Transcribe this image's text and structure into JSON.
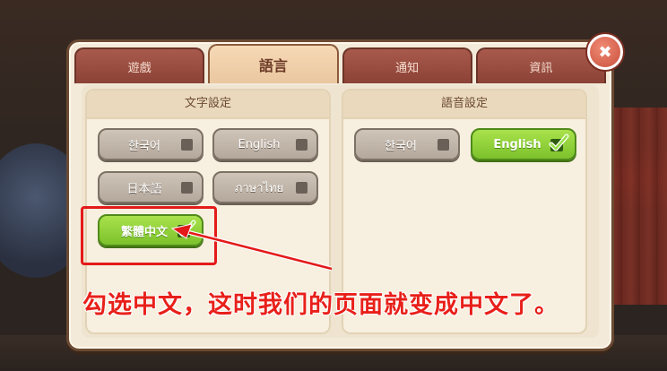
{
  "tabs": [
    {
      "label": "遊戲",
      "active": false
    },
    {
      "label": "語言",
      "active": true
    },
    {
      "label": "通知",
      "active": false
    },
    {
      "label": "資訊",
      "active": false
    }
  ],
  "text_settings": {
    "title": "文字設定",
    "options": [
      {
        "label": "한국어",
        "selected": false
      },
      {
        "label": "English",
        "selected": false
      },
      {
        "label": "日本語",
        "selected": false
      },
      {
        "label": "ภาษาไทย",
        "selected": false
      },
      {
        "label": "繁體中文",
        "selected": true
      }
    ]
  },
  "voice_settings": {
    "title": "語音設定",
    "options": [
      {
        "label": "한국어",
        "selected": false
      },
      {
        "label": "English",
        "selected": true
      }
    ]
  },
  "close": {
    "icon": "close-icon",
    "glyph": "✖"
  },
  "annotation": {
    "caption": "勾选中文，这时我们的页面就变成中文了。",
    "color": "#e41a1a"
  }
}
